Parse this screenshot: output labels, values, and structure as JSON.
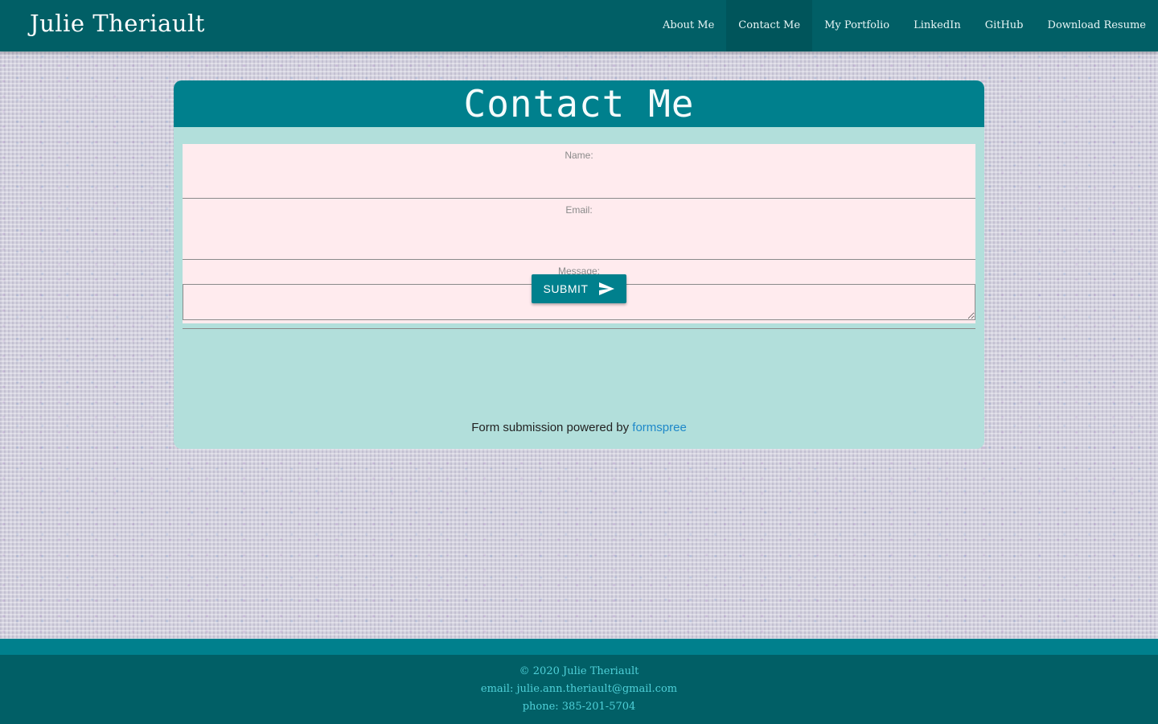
{
  "nav": {
    "brand": "Julie Theriault",
    "links": [
      {
        "label": "About Me",
        "active": false
      },
      {
        "label": "Contact Me",
        "active": true
      },
      {
        "label": "My Portfolio",
        "active": false
      },
      {
        "label": "LinkedIn",
        "active": false
      },
      {
        "label": "GitHub",
        "active": false
      },
      {
        "label": "Download Resume",
        "active": false
      }
    ]
  },
  "contact": {
    "title": "Contact Me",
    "fields": {
      "name_label": "Name:",
      "email_label": "Email:",
      "message_label": "Message:"
    },
    "submit_label": "SUBMIT",
    "submit_icon": "send-icon",
    "powered_text": "Form submission powered by",
    "powered_link": "formspree"
  },
  "footer": {
    "copyright": "© 2020 Julie Theriault",
    "email": "email: julie.ann.theriault@gmail.com",
    "phone": "phone: 385-201-5704"
  },
  "colors": {
    "nav_bg": "#015f66",
    "accent": "#00808d",
    "card_bg": "#b2dfdb",
    "field_bg": "#ffebee",
    "link": "#1e88c9",
    "footer_text": "#4fd0d8"
  }
}
